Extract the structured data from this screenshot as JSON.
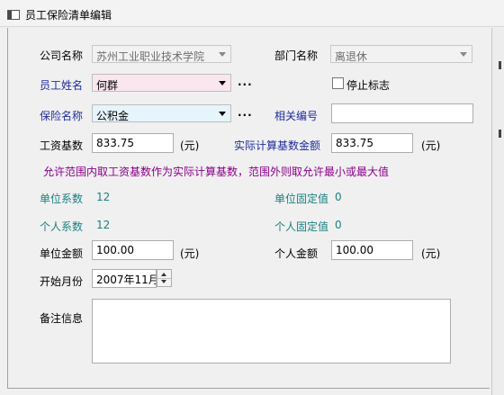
{
  "window": {
    "title": "员工保险清单编辑"
  },
  "form": {
    "company_label": "公司名称",
    "company_value": "苏州工业职业技术学院",
    "department_label": "部门名称",
    "department_value": "离退休",
    "employee_label": "员工姓名",
    "employee_value": "何群",
    "stop_flag_label": "停止标志",
    "insurance_label": "保险名称",
    "insurance_value": "公积金",
    "related_no_label": "相关编号",
    "related_no_value": "",
    "salary_base_label": "工资基数",
    "salary_base_value": "833.75",
    "actual_base_label": "实际计算基数金额",
    "actual_base_value": "833.75",
    "unit_text": "(元)",
    "hint_text": "允许范围内取工资基数作为实际计算基数，范围外则取允许最小或最大值",
    "unit_coef_label": "单位系数",
    "unit_coef_value": "12",
    "unit_fixed_label": "单位固定值",
    "unit_fixed_value": "0",
    "personal_coef_label": "个人系数",
    "personal_coef_value": "12",
    "personal_fixed_label": "个人固定值",
    "personal_fixed_value": "0",
    "unit_amount_label": "单位金额",
    "unit_amount_value": "100.00",
    "personal_amount_label": "个人金额",
    "personal_amount_value": "100.00",
    "start_month_label": "开始月份",
    "start_month_value": "2007年11月",
    "remarks_label": "备注信息",
    "remarks_value": "",
    "browse_label": "..."
  },
  "colors": {
    "employee_field_bg": "#f9e6ef",
    "insurance_field_bg": "#e6f4fb",
    "label_blue": "#1e2ca0",
    "label_teal": "#1a8080",
    "hint_purple": "#8a008a"
  }
}
